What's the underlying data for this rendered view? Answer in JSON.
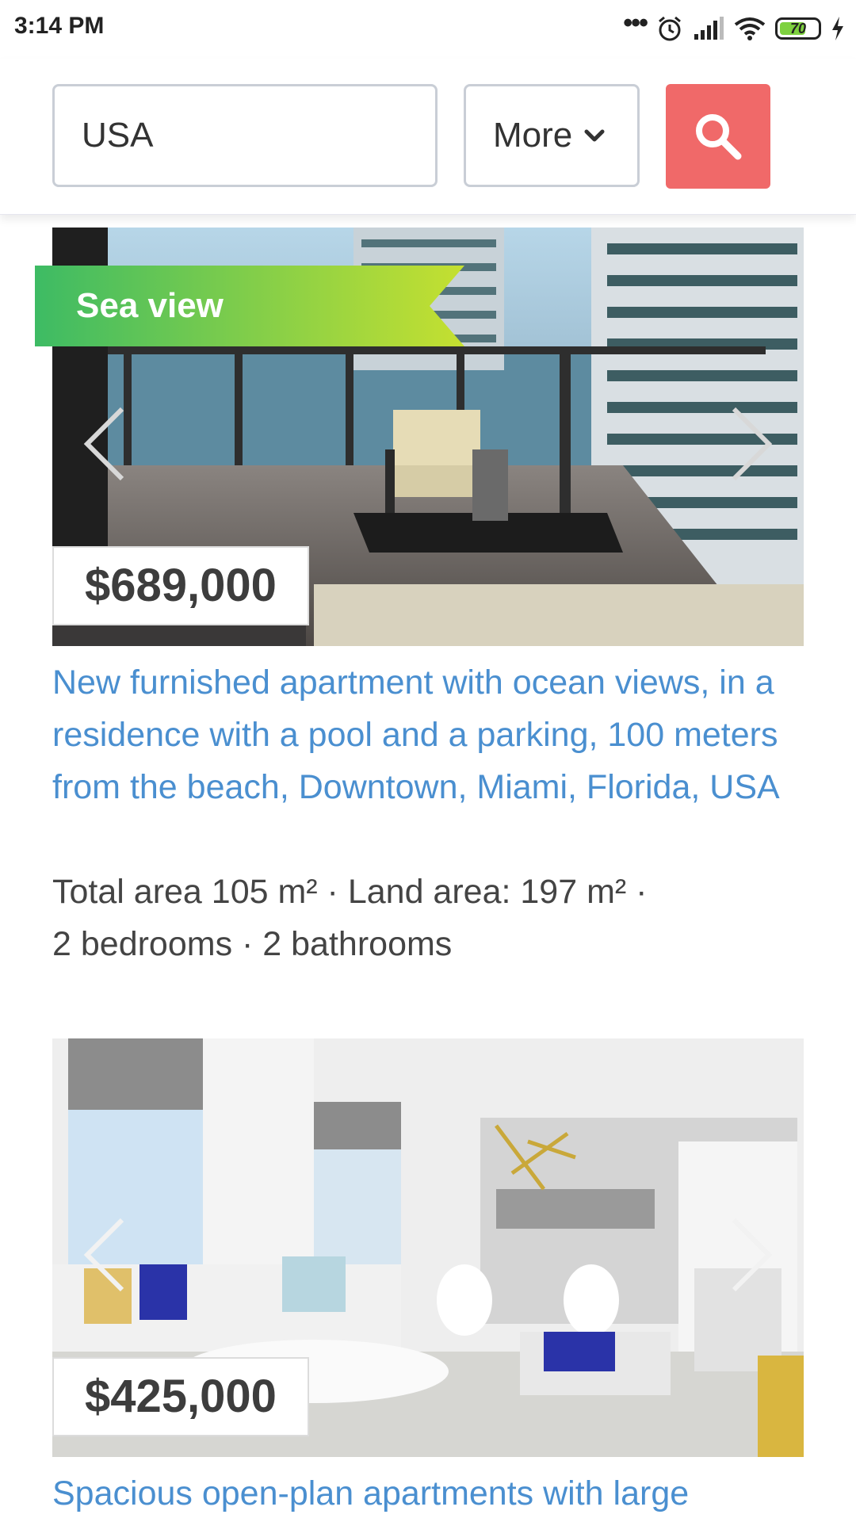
{
  "status_bar": {
    "time": "3:14 PM",
    "dots": "•••",
    "battery": "70",
    "icons": [
      "alarm-icon",
      "signal-icon",
      "wifi-icon",
      "battery-icon",
      "charging-icon"
    ]
  },
  "search": {
    "value": "USA",
    "more_label": "More",
    "button_color": "#f06969"
  },
  "listings": [
    {
      "badge": "Sea view",
      "price": "$689,000",
      "title": "New furnished apartment with ocean views, in a residence with a pool and a parking, 100 meters from the beach, Downtown, Miami, Florida, USA",
      "details_line1": "Total area 105 m²  ·  Land area: 197 m²  ·",
      "details_line2": "2 bedrooms  ·  2 bathrooms"
    },
    {
      "price": "$425,000",
      "title": "Spacious open-plan apartments with large"
    }
  ],
  "colors": {
    "link": "#4a8fd0",
    "ribbon_start": "#3dbb64",
    "ribbon_end": "#c5e030",
    "accent": "#f06969"
  }
}
